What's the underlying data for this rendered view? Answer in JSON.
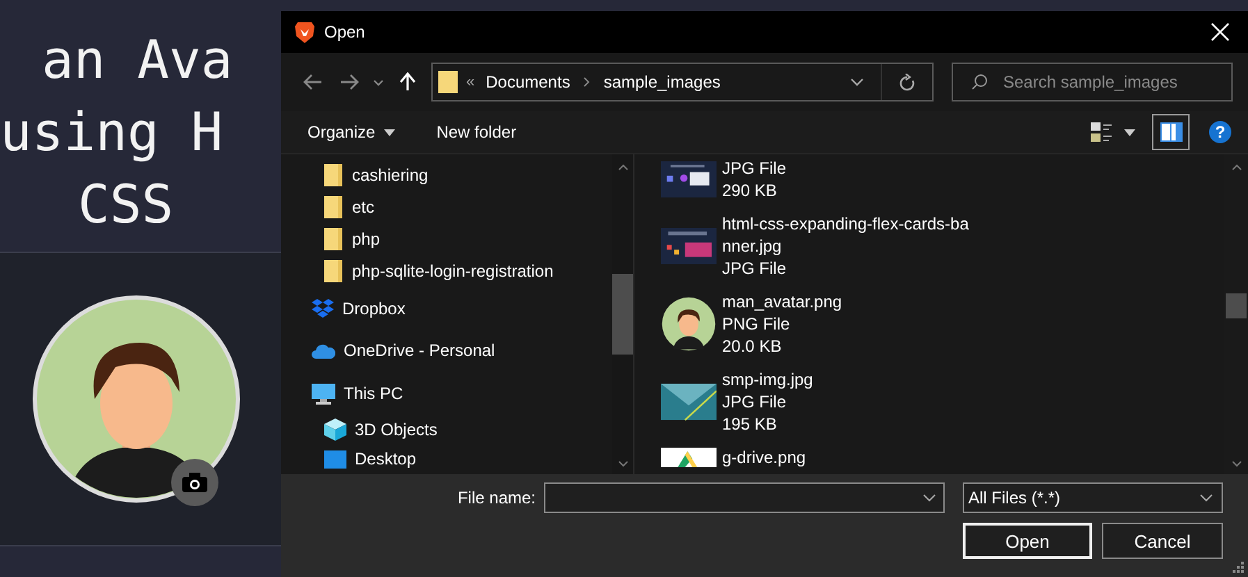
{
  "page": {
    "heading_lines": [
      "an Ava",
      "using H",
      "CSS"
    ],
    "avatar": {
      "has_upload_badge": true
    }
  },
  "dialog": {
    "title": "Open",
    "navigation": {
      "crumb_overflow": "«",
      "crumbs": [
        "Documents",
        "sample_images"
      ]
    },
    "search": {
      "placeholder": "Search sample_images"
    },
    "toolbar": {
      "buttons": [
        {
          "label": "Organize",
          "has_menu": true
        },
        {
          "label": "New folder",
          "has_menu": false
        }
      ],
      "preview_pane": {
        "on": true
      },
      "help_symbol": "?"
    },
    "nav_tree": {
      "continued_children": [
        {
          "label": "cashiering",
          "kind": "folder"
        },
        {
          "label": "etc",
          "kind": "folder"
        },
        {
          "label": "php",
          "kind": "folder"
        },
        {
          "label": "php-sqlite-login-registration",
          "kind": "folder"
        }
      ],
      "items": [
        {
          "label": "Dropbox",
          "kind": "dropbox"
        },
        {
          "label": "OneDrive - Personal",
          "kind": "cloud"
        },
        {
          "label": "This PC",
          "kind": "computer",
          "children": [
            {
              "label": "3D Objects",
              "kind": "cube"
            },
            {
              "label": "Desktop",
              "kind": "desktop"
            }
          ]
        }
      ]
    },
    "files": [
      {
        "kind": "screenshot",
        "type": "JPG File",
        "size": "290 KB"
      },
      {
        "kind": "banner",
        "name_lines": [
          "html-css-expanding-flex-cards-ba",
          "nner.jpg"
        ],
        "type": "JPG File"
      },
      {
        "kind": "avatar",
        "name_lines": [
          "man_avatar.png"
        ],
        "type": "PNG File",
        "size": "20.0 KB"
      },
      {
        "kind": "landscape",
        "name_lines": [
          "smp-img.jpg"
        ],
        "type": "JPG File",
        "size": "195 KB"
      },
      {
        "kind": "logo",
        "name_lines": [
          "g-drive.png"
        ]
      }
    ],
    "footer": {
      "file_name_label": "File name:",
      "file_type": "All Files (*.*)",
      "buttons": [
        {
          "label": "Open",
          "default": true
        },
        {
          "label": "Cancel",
          "default": false
        }
      ]
    }
  }
}
